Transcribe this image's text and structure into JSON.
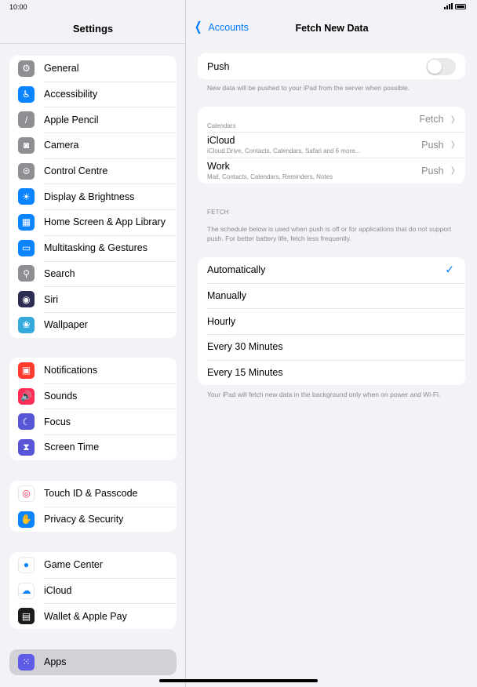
{
  "status": {
    "time": "10:00"
  },
  "sidebar": {
    "title": "Settings",
    "groups": [
      [
        {
          "label": "General",
          "icon": "gear-icon",
          "color": "#8e8e93",
          "glyph": "⚙"
        },
        {
          "label": "Accessibility",
          "icon": "accessibility-icon",
          "color": "#0a84ff",
          "glyph": "♿"
        },
        {
          "label": "Apple Pencil",
          "icon": "pencil-icon",
          "color": "#8e8e93",
          "glyph": "/"
        },
        {
          "label": "Camera",
          "icon": "camera-icon",
          "color": "#8e8e93",
          "glyph": "◙"
        },
        {
          "label": "Control Centre",
          "icon": "toggles-icon",
          "color": "#8e8e93",
          "glyph": "⊜"
        },
        {
          "label": "Display & Brightness",
          "icon": "sun-icon",
          "color": "#0a84ff",
          "glyph": "☀"
        },
        {
          "label": "Home Screen & App Library",
          "icon": "home-screen-icon",
          "color": "#0a84ff",
          "glyph": "▦"
        },
        {
          "label": "Multitasking & Gestures",
          "icon": "multitasking-icon",
          "color": "#0a84ff",
          "glyph": "▭"
        },
        {
          "label": "Search",
          "icon": "search-icon",
          "color": "#8e8e93",
          "glyph": "⚲"
        },
        {
          "label": "Siri",
          "icon": "siri-icon",
          "color": "#2c2c54",
          "glyph": "◉"
        },
        {
          "label": "Wallpaper",
          "icon": "wallpaper-icon",
          "color": "#34aadc",
          "glyph": "❀"
        }
      ],
      [
        {
          "label": "Notifications",
          "icon": "notifications-icon",
          "color": "#ff3b30",
          "glyph": "▣"
        },
        {
          "label": "Sounds",
          "icon": "speaker-icon",
          "color": "#ff2d55",
          "glyph": "🔊"
        },
        {
          "label": "Focus",
          "icon": "moon-icon",
          "color": "#5856d6",
          "glyph": "☾"
        },
        {
          "label": "Screen Time",
          "icon": "hourglass-icon",
          "color": "#5856d6",
          "glyph": "⧗"
        }
      ],
      [
        {
          "label": "Touch ID & Passcode",
          "icon": "fingerprint-icon",
          "color": "#ffffff",
          "glyph": "◎"
        },
        {
          "label": "Privacy & Security",
          "icon": "hand-icon",
          "color": "#0a84ff",
          "glyph": "✋"
        }
      ],
      [
        {
          "label": "Game Center",
          "icon": "game-center-icon",
          "color": "#ffffff",
          "glyph": "●"
        },
        {
          "label": "iCloud",
          "icon": "cloud-icon",
          "color": "#ffffff",
          "glyph": "☁"
        },
        {
          "label": "Wallet & Apple Pay",
          "icon": "wallet-icon",
          "color": "#1c1c1e",
          "glyph": "▤"
        }
      ],
      [
        {
          "label": "Apps",
          "icon": "apps-icon",
          "color": "#5e5ce6",
          "glyph": "⁙"
        }
      ]
    ]
  },
  "detail": {
    "back_label": "Accounts",
    "title": "Fetch New Data",
    "push_label": "Push",
    "push_on": false,
    "push_note": "New data will be pushed to your iPad from the server when possible.",
    "accounts": [
      {
        "name": "",
        "sub": "Calendars",
        "value": "Fetch"
      },
      {
        "name": "iCloud",
        "sub": "iCloud Drive, Contacts, Calendars, Safari and 6 more...",
        "value": "Push"
      },
      {
        "name": "Work",
        "sub": "Mail, Contacts, Calendars, Reminders, Notes",
        "value": "Push"
      }
    ],
    "fetch_header": "FETCH",
    "fetch_note": "The schedule below is used when push is off or for applications that do not support push. For better battery life, fetch less frequently.",
    "options": [
      "Automatically",
      "Manually",
      "Hourly",
      "Every 30 Minutes",
      "Every 15 Minutes"
    ],
    "selected_option": "Automatically",
    "bottom_note": "Your iPad will fetch new data in the background only when on power and Wi-Fi."
  }
}
